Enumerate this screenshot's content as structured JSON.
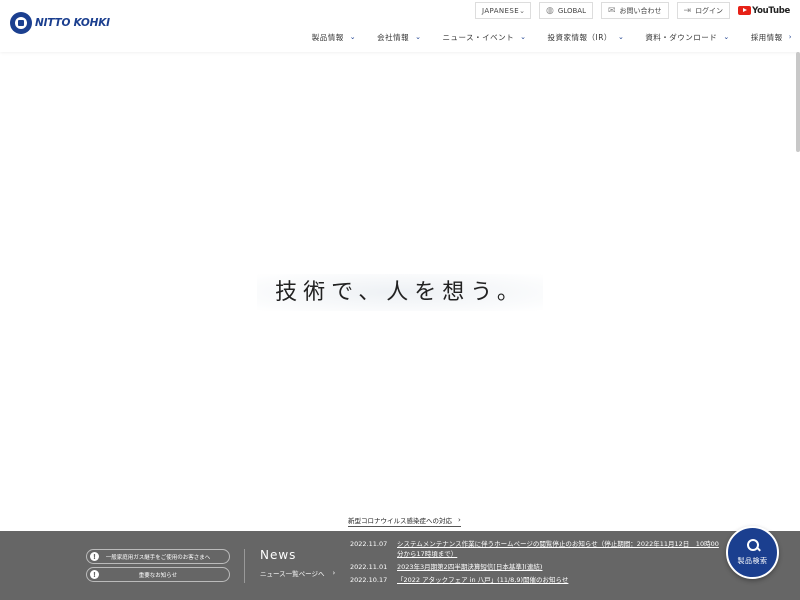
{
  "brand": {
    "name": "NITTO KOHKI"
  },
  "utility": {
    "language": "JAPANESE",
    "global": "GLOBAL",
    "contact": "お問い合わせ",
    "login": "ログイン",
    "youtube": "YouTube"
  },
  "nav": {
    "items": [
      {
        "label": "製品情報"
      },
      {
        "label": "会社情報"
      },
      {
        "label": "ニュース・イベント"
      },
      {
        "label": "投資家情報（IR）"
      },
      {
        "label": "資料・ダウンロード"
      },
      {
        "label": "採用情報"
      }
    ]
  },
  "hero": {
    "tagline": "技術で、人を想う。"
  },
  "notice": {
    "covid": "新型コロナウイルス感染症への対応"
  },
  "alerts": [
    {
      "label": "一般家庭用ガス継手をご使用のお客さまへ"
    },
    {
      "label": "重要なお知らせ"
    }
  ],
  "news": {
    "title": "News",
    "link": "ニュース一覧ページへ",
    "items": [
      {
        "date": "2022.11.07",
        "title": "システムメンテナンス作業に伴うホームページの閲覧停止のお知らせ（停止期間：2022年11月12日　10時00分から17時頃まで）"
      },
      {
        "date": "2022.11.01",
        "title": "2023年3月期第2四半期決算短信[日本基準](連結)"
      },
      {
        "date": "2022.10.17",
        "title": "「2022 アタックフェア in 八戸」(11/8,9)開催のお知らせ"
      }
    ]
  },
  "fab": {
    "label": "製品検索"
  },
  "colors": {
    "brand": "#1b3f8f",
    "band": "#666666",
    "youtube": "#e62117"
  }
}
